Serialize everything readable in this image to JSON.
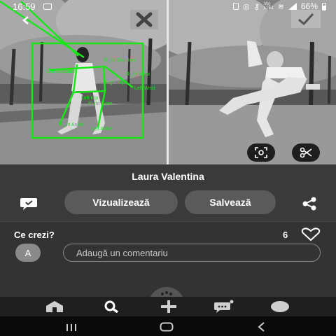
{
  "status_bar": {
    "time": "16:59",
    "icons": [
      "image-icon",
      "clipboard-icon",
      "hotspot-icon",
      "vpn-key-icon",
      "wifi-icon",
      "cellular-icon",
      "battery-icon"
    ],
    "network_label_top": "Vo)",
    "network_label_bottom": "LTE1",
    "battery": "66%"
  },
  "photos": {
    "pose_labels": [
      "Right Wrist",
      "Left Wrist",
      "Right Ankle",
      "Left Ankle",
      "Right Shoulder",
      "Left Shoulder",
      "Right Hip",
      "Left Hip",
      "Right Knee",
      "Left Knee"
    ],
    "pose_color": "#19e619",
    "left_action_icon": "close-x-icon",
    "right_action_icon": "check-icon",
    "tools": [
      "face-scan-icon",
      "scissors-icon"
    ]
  },
  "post": {
    "author": "Laura Valentina"
  },
  "actions": {
    "comment_icon": "chat-bubble-icon",
    "view_label": "Vizualizează",
    "save_label": "Salvează",
    "share_icon": "share-icon"
  },
  "comments": {
    "question": "Ce crezi?",
    "likes": "6",
    "avatar_initial": "A",
    "placeholder": "Adaugă un comentariu"
  },
  "bottom_nav": {
    "items": [
      "home-icon",
      "search-icon",
      "add-icon",
      "messages-icon",
      "profile-icon"
    ]
  },
  "system_nav": {
    "items": [
      "recents-icon",
      "home-button-icon",
      "back-icon"
    ]
  }
}
